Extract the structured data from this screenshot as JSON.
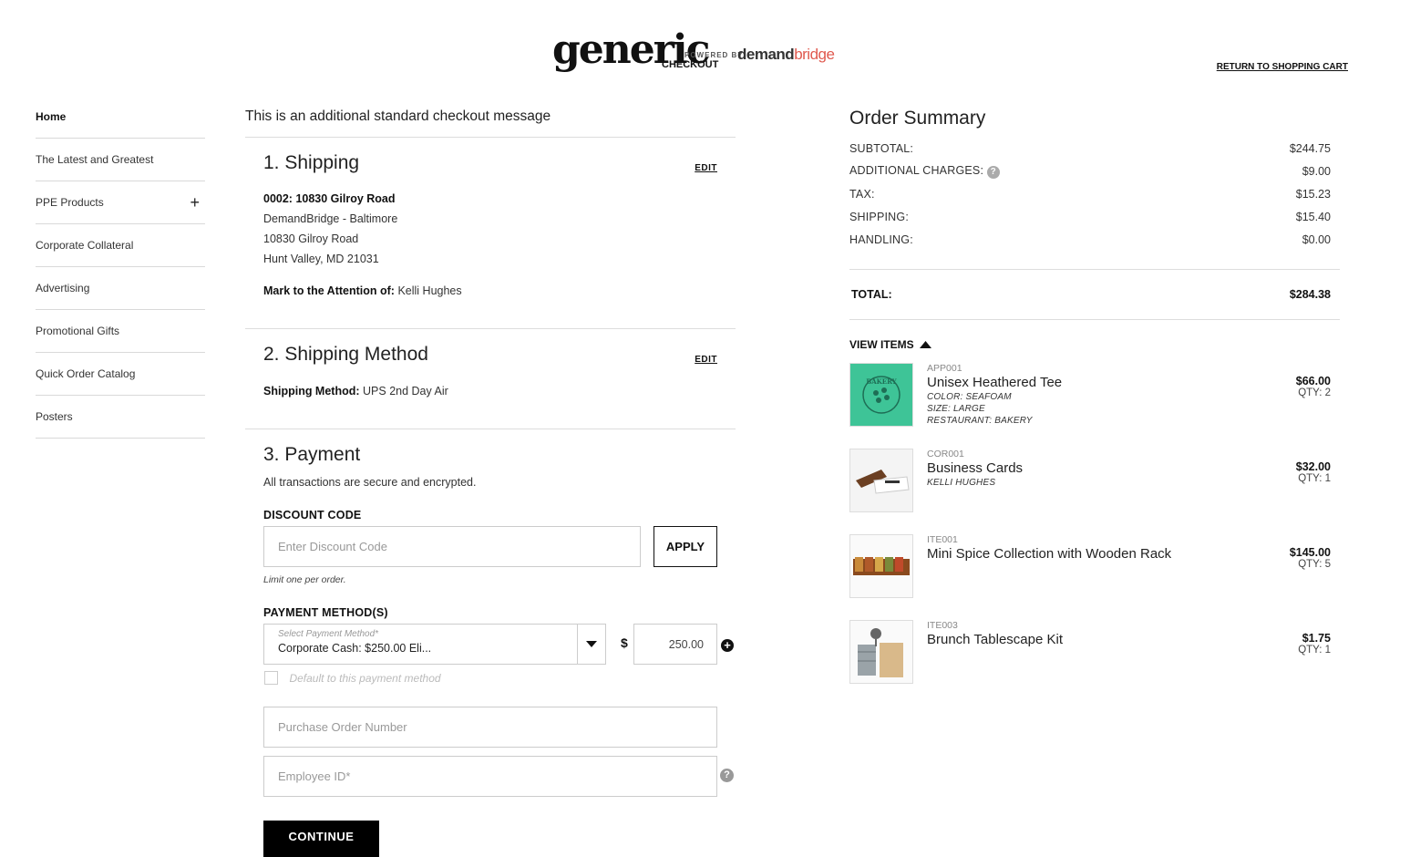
{
  "header": {
    "logo_main": "generic",
    "logo_powered": "POWERED BY",
    "logo_brand_a": "demand",
    "logo_brand_b": "bridge",
    "logo_sub": "CHECKOUT",
    "return_link": "RETURN TO SHOPPING CART"
  },
  "sidebar": {
    "items": [
      {
        "label": "Home",
        "active": true
      },
      {
        "label": "The Latest and Greatest"
      },
      {
        "label": "PPE Products",
        "expandable": true
      },
      {
        "label": "Corporate Collateral"
      },
      {
        "label": "Advertising"
      },
      {
        "label": "Promotional Gifts"
      },
      {
        "label": "Quick Order Catalog"
      },
      {
        "label": "Posters"
      }
    ],
    "expand_symbol": "+"
  },
  "main": {
    "message": "This is an additional standard checkout message",
    "shipping": {
      "title": "1. Shipping",
      "edit": "EDIT",
      "address_name": "0002: 10830 Gilroy Road",
      "company": "DemandBridge - Baltimore",
      "street": "10830 Gilroy Road",
      "city": "Hunt Valley, MD 21031",
      "attention_label": "Mark to the Attention of:",
      "attention_value": "Kelli Hughes"
    },
    "shipping_method": {
      "title": "2. Shipping Method",
      "edit": "EDIT",
      "label": "Shipping Method:",
      "value": "UPS 2nd Day Air"
    },
    "payment": {
      "title": "3. Payment",
      "secure_note": "All transactions are secure and encrypted.",
      "discount_label": "DISCOUNT CODE",
      "discount_placeholder": "Enter Discount Code",
      "apply": "APPLY",
      "limit_note": "Limit one per order.",
      "methods_label": "PAYMENT METHOD(S)",
      "select_label": "Select Payment Method*",
      "select_value": "Corporate Cash: $250.00 Eli...",
      "currency": "$",
      "amount": "250.00",
      "add_symbol": "+",
      "default_label": "Default to this payment method",
      "po_placeholder": "Purchase Order Number",
      "employee_placeholder": "Employee ID*",
      "help_symbol": "?",
      "continue": "CONTINUE"
    }
  },
  "summary": {
    "title": "Order Summary",
    "rows": [
      {
        "label": "SUBTOTAL:",
        "value": "$244.75"
      },
      {
        "label": "ADDITIONAL CHARGES:",
        "value": "$9.00",
        "help": true
      },
      {
        "label": "TAX:",
        "value": "$15.23"
      },
      {
        "label": "SHIPPING:",
        "value": "$15.40"
      },
      {
        "label": "HANDLING:",
        "value": "$0.00"
      }
    ],
    "total_label": "TOTAL:",
    "total_value": "$284.38",
    "view_items": "VIEW ITEMS",
    "items": [
      {
        "sku": "APP001",
        "name": "Unisex Heathered Tee",
        "options": [
          "COLOR: SEAFOAM",
          "SIZE: LARGE",
          "RESTAURANT: BAKERY"
        ],
        "price": "$66.00",
        "qty": "QTY: 2",
        "thumb_text": "BAKERY"
      },
      {
        "sku": "COR001",
        "name": "Business Cards",
        "options": [
          "KELLI HUGHES"
        ],
        "price": "$32.00",
        "qty": "QTY: 1"
      },
      {
        "sku": "ITE001",
        "name": "Mini Spice Collection with Wooden Rack",
        "options": [],
        "price": "$145.00",
        "qty": "QTY: 5"
      },
      {
        "sku": "ITE003",
        "name": "Brunch Tablescape Kit",
        "options": [],
        "price": "$1.75",
        "qty": "QTY: 1"
      }
    ]
  },
  "colors": {
    "brand_accent": "#e05a4f",
    "tee_green": "#3ec497",
    "button_dark": "#000000"
  }
}
